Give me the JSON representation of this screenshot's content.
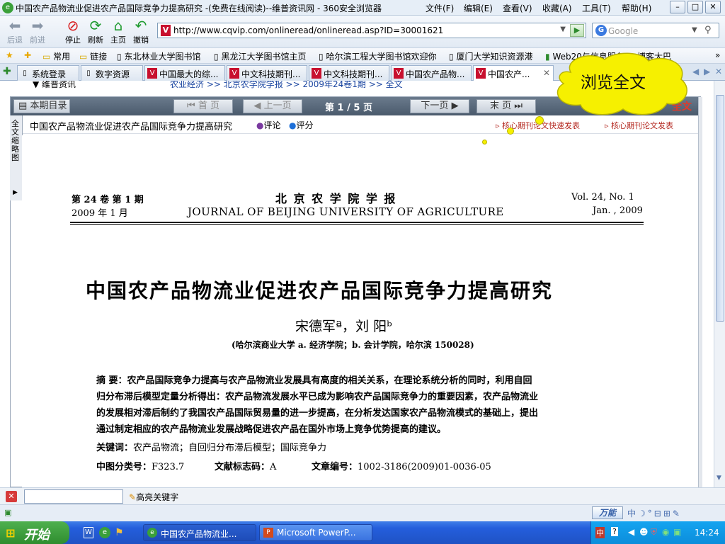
{
  "window": {
    "title": "中国农产品物流业促进农产品国际竞争力提高研究 -(免费在线阅读)--维普资讯网 - 360安全浏览器",
    "menu": [
      "文件(F)",
      "编辑(E)",
      "查看(V)",
      "收藏(A)",
      "工具(T)",
      "帮助(H)"
    ],
    "min": "–",
    "max": "□",
    "close": "✕"
  },
  "toolbar": {
    "back": "后退",
    "forward": "前进",
    "stop": "停止",
    "refresh": "刷新",
    "home": "主页",
    "undo": "撤销",
    "address": "http://www.cqvip.com/onlineread/onlineread.asp?ID=30001621",
    "address_icon": "V",
    "search_placeholder": "Google"
  },
  "favorites": [
    "常用",
    "链接",
    "东北林业大学图书馆",
    "黑龙江大学图书馆主页",
    "哈尔滨工程大学图书馆欢迎你",
    "厦门大学知识资源港",
    "Web20与信息服务",
    "博客大巴"
  ],
  "tabs": [
    "系统登录",
    "数字资源",
    "中国最大的综...",
    "中文科技期刊...",
    "中文科技期刊...",
    "中国农产品物...",
    "中国农产..."
  ],
  "breadcrumb": {
    "top_left": "维普资讯",
    "path": "农业经济 >> 北京农学院学报 >> 2009年24卷1期 >> 全文"
  },
  "reader": {
    "toc": "本期目录",
    "first": "首 页",
    "prev": "上一页",
    "page": "第 1 / 5 页",
    "next": "下一页",
    "last": "末 页",
    "fulltext": "全文",
    "side_tab": "全文缩略图",
    "article_title": "中国农产品物流业促进农产品国际竞争力提高研究",
    "comment": "评论",
    "rate": "评分",
    "ad1": "核心期刊论文快速发表",
    "ad2": "核心期刊论文发表"
  },
  "bubble": "浏览全文",
  "paper": {
    "vol_cn": "第 24 卷   第 1 期",
    "date_cn": "2009 年 1 月",
    "journal_cn": "北 京 农 学 院 学 报",
    "journal_en": "JOURNAL OF BEIJING UNIVERSITY OF AGRICULTURE",
    "vol_en": "Vol. 24, No. 1",
    "date_en": "Jan. , 2009",
    "title": "中国农产品物流业促进农产品国际竞争力提高研究",
    "authors": "宋德军ª，刘  阳ᵇ",
    "affil": "(哈尔滨商业大学 a. 经济学院；b. 会计学院，哈尔滨 150028)",
    "abstract_label": "摘  要：",
    "abstract_lines": [
      "农产品国际竞争力提高与农产品物流业发展具有高度的相关关系，在理论系统分析的同时，利用自回",
      "归分布滞后模型定量分析得出：农产品物流发展水平已成为影响农产品国际竞争力的重要因素，农产品物流业",
      "的发展相对滞后制约了我国农产品国际贸易量的进一步提高，在分析发达国家农产品物流模式的基础上，提出",
      "通过制定相应的农产品物流业发展战略促进农产品在国外市场上竞争优势提高的建议。"
    ],
    "keywords_label": "关键词：",
    "keywords": "农产品物流；自回归分布滞后模型；国际竞争力",
    "clc_label": "中图分类号：",
    "clc": "F323.7",
    "doc_label": "文献标志码：",
    "doc": "A",
    "article_label": "文章编号：",
    "article_no": "1002-3186(2009)01-0036-05"
  },
  "findbar": {
    "highlight": "高亮关键字"
  },
  "statusbar": {
    "speed": "万能"
  },
  "taskbar": {
    "start": "开始",
    "tasks": [
      "中国农产品物流业...",
      "Microsoft PowerP..."
    ],
    "time": "14:24"
  }
}
